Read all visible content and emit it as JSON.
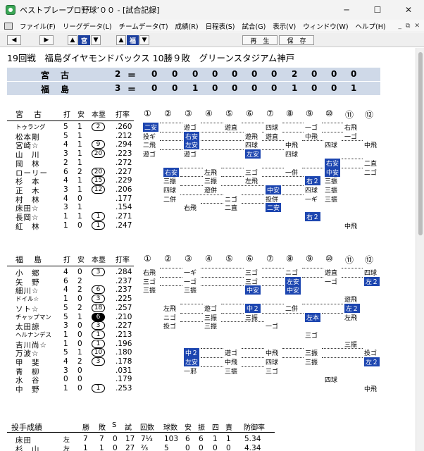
{
  "window": {
    "title": "ベストプレープロ野球’００ - [試合記録]"
  },
  "menu": [
    "ファイル(F)",
    "リーグデータ(L)",
    "チームデータ(T)",
    "成績(R)",
    "日程表(S)",
    "試合(G)",
    "表示(V)",
    "ウィンドウ(W)",
    "ヘルプ(H)"
  ],
  "toolbar": {
    "team_away": "宮",
    "team_home": "福",
    "play": "再　生",
    "save": "保　存"
  },
  "game": {
    "info": "19回戦　福島ダイヤモンドバックス 10勝９敗　グリーンスタジアム神戸"
  },
  "linescore": [
    {
      "team": "宮　古",
      "total": "2",
      "innings": [
        "0",
        "0",
        "0",
        "0",
        "0",
        "0",
        "0",
        "2",
        "0",
        "0",
        "0"
      ]
    },
    {
      "team": "福　島",
      "total": "3",
      "innings": [
        "0",
        "0",
        "1",
        "0",
        "0",
        "0",
        "0",
        "1",
        "0",
        "0",
        "1"
      ]
    }
  ],
  "batting_headers": {
    "h_ab": "打",
    "h_h": "安",
    "h_hr": "本塁",
    "h_avg": "打率",
    "innings": [
      "①",
      "②",
      "③",
      "④",
      "⑤",
      "⑥",
      "⑦",
      "⑧",
      "⑨",
      "⑩",
      "⑪",
      "⑫"
    ]
  },
  "away": {
    "team": "宮　古",
    "batters": [
      {
        "name": "トゥラング",
        "small": true,
        "ab": "5",
        "h": "1",
        "hr": "2",
        "avg": ".260",
        "cells": [
          [
            1,
            "二安",
            true
          ],
          [
            3,
            "遊ゴ",
            false
          ],
          [
            5,
            "遊直",
            false
          ],
          [
            7,
            "四球",
            false
          ],
          [
            9,
            "一ゴ",
            false
          ],
          [
            11,
            "右飛",
            false
          ]
        ]
      },
      {
        "name": "松本剛",
        "ab": "5",
        "h": "1",
        "hr": "",
        "avg": ".212",
        "cells": [
          [
            1,
            "投ギ",
            false
          ],
          [
            3,
            "右安",
            true
          ],
          [
            6,
            "遊飛",
            false
          ],
          [
            7,
            "遊直",
            false
          ],
          [
            9,
            "中飛",
            false
          ],
          [
            11,
            "一ゴ",
            false
          ]
        ]
      },
      {
        "name": "宮崎☆",
        "ab": "4",
        "h": "1",
        "hr": "9",
        "avg": ".294",
        "cells": [
          [
            1,
            "二飛",
            false
          ],
          [
            3,
            "左安",
            true
          ],
          [
            6,
            "四球",
            false
          ],
          [
            8,
            "中飛",
            false
          ],
          [
            10,
            "四球",
            false
          ],
          [
            12,
            "中飛",
            false
          ]
        ]
      },
      {
        "name": "山　川",
        "ab": "3",
        "h": "1",
        "hr": "20",
        "avg": ".223",
        "cells": [
          [
            1,
            "遊ゴ",
            false
          ],
          [
            3,
            "遊ゴ",
            false
          ],
          [
            6,
            "左安",
            true
          ],
          [
            8,
            "四球",
            false
          ]
        ]
      },
      {
        "name": "岡　林",
        "ab": "2",
        "h": "1",
        "hr": "",
        "avg": ".272",
        "cells": [
          [
            10,
            "右安",
            true
          ],
          [
            12,
            "二直",
            false
          ]
        ]
      },
      {
        "name": "ローリー",
        "ab": "6",
        "h": "2",
        "hr": "20",
        "avg": ".227",
        "cells": [
          [
            2,
            "右安",
            true
          ],
          [
            4,
            "左飛",
            false
          ],
          [
            6,
            "三ゴ",
            false
          ],
          [
            8,
            "一併",
            false
          ],
          [
            10,
            "中安",
            true
          ],
          [
            12,
            "二ゴ",
            false
          ]
        ]
      },
      {
        "name": "杉　本",
        "ab": "4",
        "h": "1",
        "hr": "15",
        "avg": ".229",
        "cells": [
          [
            2,
            "三振",
            false
          ],
          [
            4,
            "三振",
            false
          ],
          [
            6,
            "左飛",
            false
          ],
          [
            9,
            "右２",
            true
          ],
          [
            10,
            "三振",
            false
          ]
        ]
      },
      {
        "name": "正　木",
        "ab": "3",
        "h": "1",
        "hr": "12",
        "avg": ".206",
        "cells": [
          [
            2,
            "四球",
            false
          ],
          [
            4,
            "遊併",
            false
          ],
          [
            7,
            "中安",
            true
          ],
          [
            9,
            "四球",
            false
          ],
          [
            10,
            "三振",
            false
          ]
        ]
      },
      {
        "name": "村　林",
        "ab": "4",
        "h": "0",
        "hr": "",
        "avg": ".177",
        "cells": [
          [
            2,
            "二併",
            false
          ],
          [
            5,
            "ニゴ",
            false
          ],
          [
            7,
            "投併",
            false
          ],
          [
            9,
            "一ギ",
            false
          ],
          [
            10,
            "三振",
            false
          ]
        ]
      },
      {
        "name": "床田☆",
        "ab": "3",
        "h": "1",
        "hr": "",
        "avg": ".154",
        "cells": [
          [
            3,
            "右飛",
            false
          ],
          [
            5,
            "二直",
            false
          ],
          [
            7,
            "二安",
            true
          ]
        ]
      },
      {
        "name": "長岡☆",
        "ab": "1",
        "h": "1",
        "hr": "1",
        "avg": ".271",
        "cells": [
          [
            9,
            "右２",
            true
          ]
        ]
      },
      {
        "name": "紅　林",
        "ab": "1",
        "h": "0",
        "hr": "1",
        "avg": ".247",
        "cells": [
          [
            11,
            "中飛",
            false
          ]
        ]
      }
    ]
  },
  "home": {
    "team": "福　島",
    "batters": [
      {
        "name": "小　郷",
        "ab": "4",
        "h": "0",
        "hr": "3",
        "avg": ".284",
        "cells": [
          [
            1,
            "右飛",
            false
          ],
          [
            3,
            "一ギ",
            false
          ],
          [
            6,
            "三ゴ",
            false
          ],
          [
            8,
            "ニゴ",
            false
          ],
          [
            10,
            "遊直",
            false
          ],
          [
            12,
            "四球",
            false
          ]
        ]
      },
      {
        "name": "矢　野",
        "ab": "6",
        "h": "2",
        "hr": "",
        "avg": ".237",
        "cells": [
          [
            1,
            "三ゴ",
            false
          ],
          [
            3,
            "一ゴ",
            false
          ],
          [
            6,
            "三ゴ",
            false
          ],
          [
            8,
            "左安",
            true
          ],
          [
            10,
            "一ゴ",
            false
          ],
          [
            12,
            "左２",
            true
          ]
        ]
      },
      {
        "name": "細川☆",
        "ab": "4",
        "h": "2",
        "hr": "6",
        "avg": ".237",
        "cells": [
          [
            1,
            "三振",
            false
          ],
          [
            3,
            "三振",
            false
          ],
          [
            6,
            "中安",
            true
          ],
          [
            8,
            "中安",
            true
          ]
        ]
      },
      {
        "name": "ドイル☆",
        "small": true,
        "ab": "1",
        "h": "0",
        "hr": "3",
        "avg": ".225",
        "cells": [
          [
            11,
            "遊飛",
            false
          ]
        ]
      },
      {
        "name": "ソト☆",
        "ab": "5",
        "h": "2",
        "hr": "18",
        "avg": ".257",
        "cells": [
          [
            2,
            "左飛",
            false
          ],
          [
            4,
            "遊ゴ",
            false
          ],
          [
            6,
            "中２",
            true
          ],
          [
            8,
            "二併",
            false
          ],
          [
            11,
            "左２",
            true
          ]
        ]
      },
      {
        "name": "チャップマン",
        "small": true,
        "ab": "5",
        "h": "1",
        "hr": "6",
        "hrfilled": true,
        "avg": ".210",
        "cells": [
          [
            2,
            "ニゴ",
            false
          ],
          [
            4,
            "三振",
            false
          ],
          [
            6,
            "三振",
            false
          ],
          [
            9,
            "左本",
            true
          ],
          [
            11,
            "左飛",
            false
          ]
        ]
      },
      {
        "name": "太田諒",
        "ab": "3",
        "h": "0",
        "hr": "3",
        "avg": ".227",
        "cells": [
          [
            2,
            "投ゴ",
            false
          ],
          [
            4,
            "三振",
            false
          ],
          [
            7,
            "一ゴ",
            false
          ]
        ]
      },
      {
        "name": "ヘルナンデス",
        "small": true,
        "ab": "1",
        "h": "0",
        "hr": "1",
        "avg": ".213",
        "cells": [
          [
            9,
            "三ゴ",
            false
          ]
        ]
      },
      {
        "name": "吉川尚☆",
        "ab": "1",
        "h": "0",
        "hr": "1",
        "avg": ".196",
        "cells": [
          [
            11,
            "三振",
            false
          ]
        ]
      },
      {
        "name": "万波☆",
        "ab": "5",
        "h": "1",
        "hr": "10",
        "avg": ".180",
        "cells": [
          [
            3,
            "中２",
            true
          ],
          [
            5,
            "遊ゴ",
            false
          ],
          [
            7,
            "中飛",
            false
          ],
          [
            9,
            "三振",
            false
          ],
          [
            12,
            "投ゴ",
            false
          ]
        ]
      },
      {
        "name": "甲　斐",
        "ab": "4",
        "h": "2",
        "hr": "3",
        "avg": ".178",
        "cells": [
          [
            3,
            "左安",
            true
          ],
          [
            5,
            "中飛",
            false
          ],
          [
            7,
            "四球",
            false
          ],
          [
            9,
            "三振",
            false
          ],
          [
            12,
            "左２",
            true
          ]
        ]
      },
      {
        "name": "青　柳",
        "ab": "3",
        "h": "0",
        "hr": "",
        "avg": ".031",
        "cells": [
          [
            3,
            "一邪",
            false
          ],
          [
            5,
            "三振",
            false
          ],
          [
            7,
            "三ゴ",
            false
          ]
        ]
      },
      {
        "name": "水　谷",
        "ab": "0",
        "h": "0",
        "hr": "",
        "avg": ".179",
        "cells": [
          [
            10,
            "四球",
            false
          ]
        ]
      },
      {
        "name": "中　野",
        "ab": "1",
        "h": "0",
        "hr": "1",
        "avg": ".253",
        "cells": [
          [
            12,
            "中飛",
            false
          ]
        ]
      }
    ]
  },
  "pitching": {
    "title": "投手成績",
    "headers": [
      "勝",
      "敗",
      "S",
      "試",
      "回数",
      "球数",
      "安",
      "振",
      "四",
      "責",
      "防御率"
    ],
    "rows": [
      {
        "name": "床田",
        "side": "左",
        "vals": [
          "7",
          "7",
          "0",
          "17",
          "7⅓",
          "103",
          "6",
          "6",
          "1",
          "1",
          "5.34"
        ]
      },
      {
        "name": "杉　山",
        "side": "左",
        "vals": [
          "1",
          "1",
          "0",
          "27",
          "⅔",
          "5",
          "0",
          "0",
          "0",
          "0",
          "4.34"
        ]
      }
    ]
  }
}
